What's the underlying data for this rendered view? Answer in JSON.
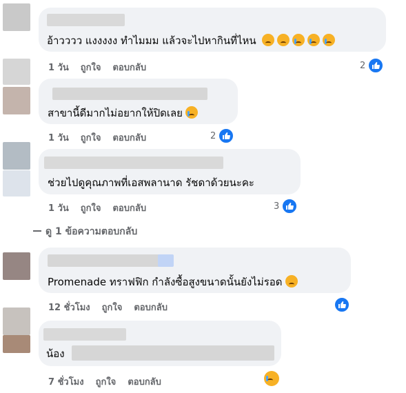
{
  "comments": [
    {
      "text": "อ้าวววว แงงงงง ทำไมมม แล้วจะไปหากินที่ไหน",
      "time": "1 วัน",
      "like": "ถูกใจ",
      "reply": "ตอบกลับ",
      "count": "2"
    },
    {
      "text": "สาขานี้ดีมากไม่อยากให้ปิดเลย",
      "time": "1 วัน",
      "like": "ถูกใจ",
      "reply": "ตอบกลับ",
      "count": "2"
    },
    {
      "text": "ช่วยไปดูคุณภาพที่เอสพลานาด รัชดาด้วยนะคะ",
      "time": "1 วัน",
      "like": "ถูกใจ",
      "reply": "ตอบกลับ",
      "count": "3"
    },
    {
      "text": "Promenade ทราฟฟิก กำลังซื้อสูงขนาดนั้นยังไม่รอด",
      "time": "12 ชั่วโมง",
      "like": "ถูกใจ",
      "reply": "ตอบกลับ",
      "count": ""
    },
    {
      "text": "น้อง",
      "time": "7 ชั่วโมง",
      "like": "ถูกใจ",
      "reply": "ตอบกลับ",
      "count": ""
    }
  ],
  "view_replies": "ดู 1 ข้อความตอบกลับ",
  "colors": {
    "like_blue": "#1877f2",
    "bubble": "#f0f2f5",
    "meta": "#65676b"
  }
}
